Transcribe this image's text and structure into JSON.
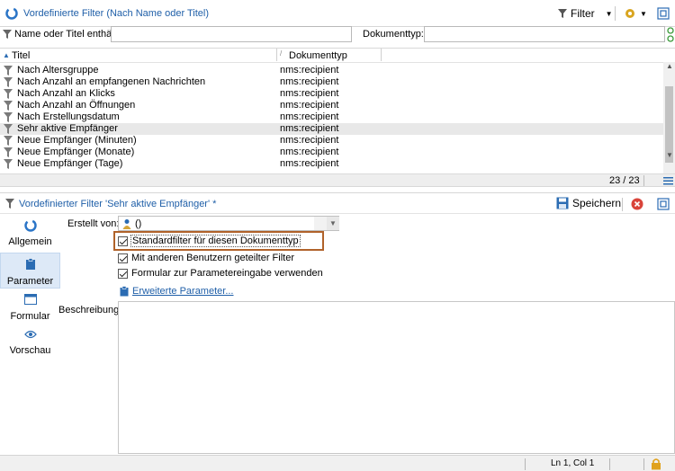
{
  "window": {
    "title": "Vordefinierte Filter (Nach Name oder Titel)"
  },
  "toolbar": {
    "filter_label": "Filter"
  },
  "search": {
    "name_label": "Name oder Titel enthält:",
    "name_value": "",
    "doctype_label": "Dokumenttyp:",
    "doctype_value": ""
  },
  "table": {
    "col_title": "Titel",
    "col_type": "Dokumenttyp",
    "rows": [
      {
        "title": "Nach Altersgruppe",
        "type": "nms:recipient"
      },
      {
        "title": "Nach Anzahl an empfangenen Nachrichten",
        "type": "nms:recipient"
      },
      {
        "title": "Nach Anzahl an Klicks",
        "type": "nms:recipient"
      },
      {
        "title": "Nach Anzahl an Öffnungen",
        "type": "nms:recipient"
      },
      {
        "title": "Nach Erstellungsdatum",
        "type": "nms:recipient"
      },
      {
        "title": "Sehr aktive Empfänger",
        "type": "nms:recipient"
      },
      {
        "title": "Neue Empfänger (Minuten)",
        "type": "nms:recipient"
      },
      {
        "title": "Neue Empfänger (Monate)",
        "type": "nms:recipient"
      },
      {
        "title": "Neue Empfänger (Tage)",
        "type": "nms:recipient"
      }
    ],
    "count": "23 / 23"
  },
  "detail": {
    "title": "Vordefinierter Filter 'Sehr aktive Empfänger' *",
    "save_label": "Speichern",
    "nav": [
      {
        "label": "Allgemein",
        "icon": "globe-icon"
      },
      {
        "label": "Parameter",
        "icon": "clipboard-icon"
      },
      {
        "label": "Formular",
        "icon": "form-icon"
      },
      {
        "label": "Vorschau",
        "icon": "eye-icon"
      }
    ],
    "created_by_label": "Erstellt von:",
    "created_by_value": "()",
    "opt_default": "Standardfilter für diesen Dokumenttyp",
    "opt_shared": "Mit anderen Benutzern geteilter Filter",
    "opt_form": "Formular zur Parametereingabe verwenden",
    "advanced_link": "Erweiterte Parameter...",
    "description_label": "Beschreibung:"
  },
  "status": {
    "position": "Ln 1, Col 1"
  },
  "colors": {
    "accent": "#1f5fa8",
    "highlight_box": "#b0622a",
    "save_icon": "#2b6cb3",
    "close_icon": "#d9443a"
  }
}
